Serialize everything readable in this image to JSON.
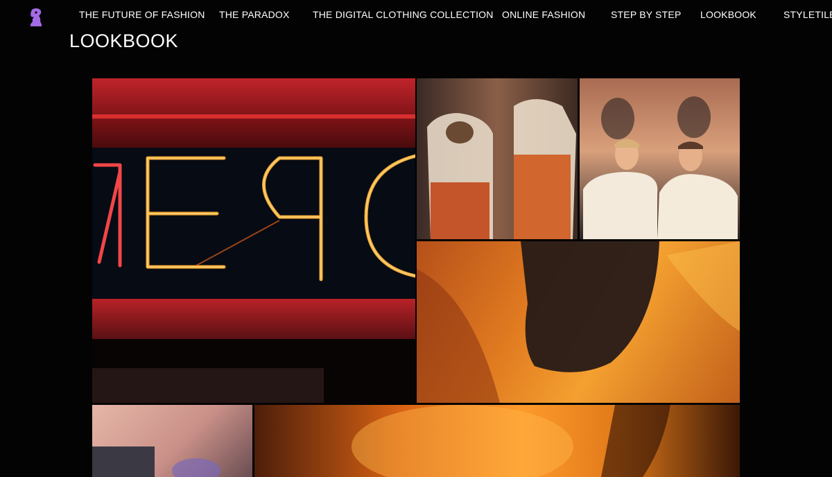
{
  "nav": {
    "logo_icon": "purple-chess-knight-logo",
    "items": [
      {
        "label": "THE FUTURE OF FASHION"
      },
      {
        "label": "THE PARADOX"
      },
      {
        "label": "THE DIGITAL CLOTHING COLLECTION"
      },
      {
        "label": "ONLINE FASHION"
      },
      {
        "label": "STEP BY STEP"
      },
      {
        "label": "LOOKBOOK"
      },
      {
        "label": "STYLETILE"
      }
    ]
  },
  "page": {
    "title": "LOOKBOOK"
  },
  "colors": {
    "background": "#030303",
    "text": "#ffffff",
    "logo": "#a36be6",
    "neon": "#ff6a1a"
  }
}
